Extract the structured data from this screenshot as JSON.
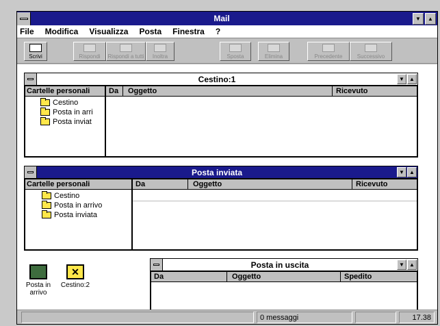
{
  "window": {
    "title": "Mail"
  },
  "menu": [
    "File",
    "Modifica",
    "Visualizza",
    "Posta",
    "Finestra",
    "?"
  ],
  "toolbar": [
    {
      "label": "Scrivi",
      "enabled": true
    },
    {
      "label": "Rispondi",
      "enabled": false
    },
    {
      "label": "Rispondi a tutti",
      "enabled": false
    },
    {
      "label": "Inoltra",
      "enabled": false
    },
    {
      "label": "Sposta",
      "enabled": false
    },
    {
      "label": "Elimina",
      "enabled": false
    },
    {
      "label": "Precedente",
      "enabled": false
    },
    {
      "label": "Successivo",
      "enabled": false
    }
  ],
  "windows": {
    "cestino": {
      "title": "Cestino:1",
      "folders_header": "Cartelle personali",
      "columns": [
        "Da",
        "Oggetto",
        "Ricevuto"
      ],
      "folders": [
        "Cestino",
        "Posta in arri",
        "Posta inviat"
      ]
    },
    "inviata": {
      "title": "Posta inviata",
      "folders_header": "Cartelle personali",
      "columns": [
        "Da",
        "Oggetto",
        "Ricevuto"
      ],
      "folders": [
        "Cestino",
        "Posta in arrivo",
        "Posta inviata"
      ]
    },
    "uscita": {
      "title": "Posta in uscita",
      "columns": [
        "Da",
        "Oggetto",
        "Spedito"
      ]
    }
  },
  "icons": [
    {
      "label": "Posta in arrivo",
      "icon": "inbox-icon"
    },
    {
      "label": "Cestino:2",
      "icon": "recycle-bin-icon"
    }
  ],
  "status": {
    "messages": "0 messaggi",
    "time": "17.38"
  }
}
